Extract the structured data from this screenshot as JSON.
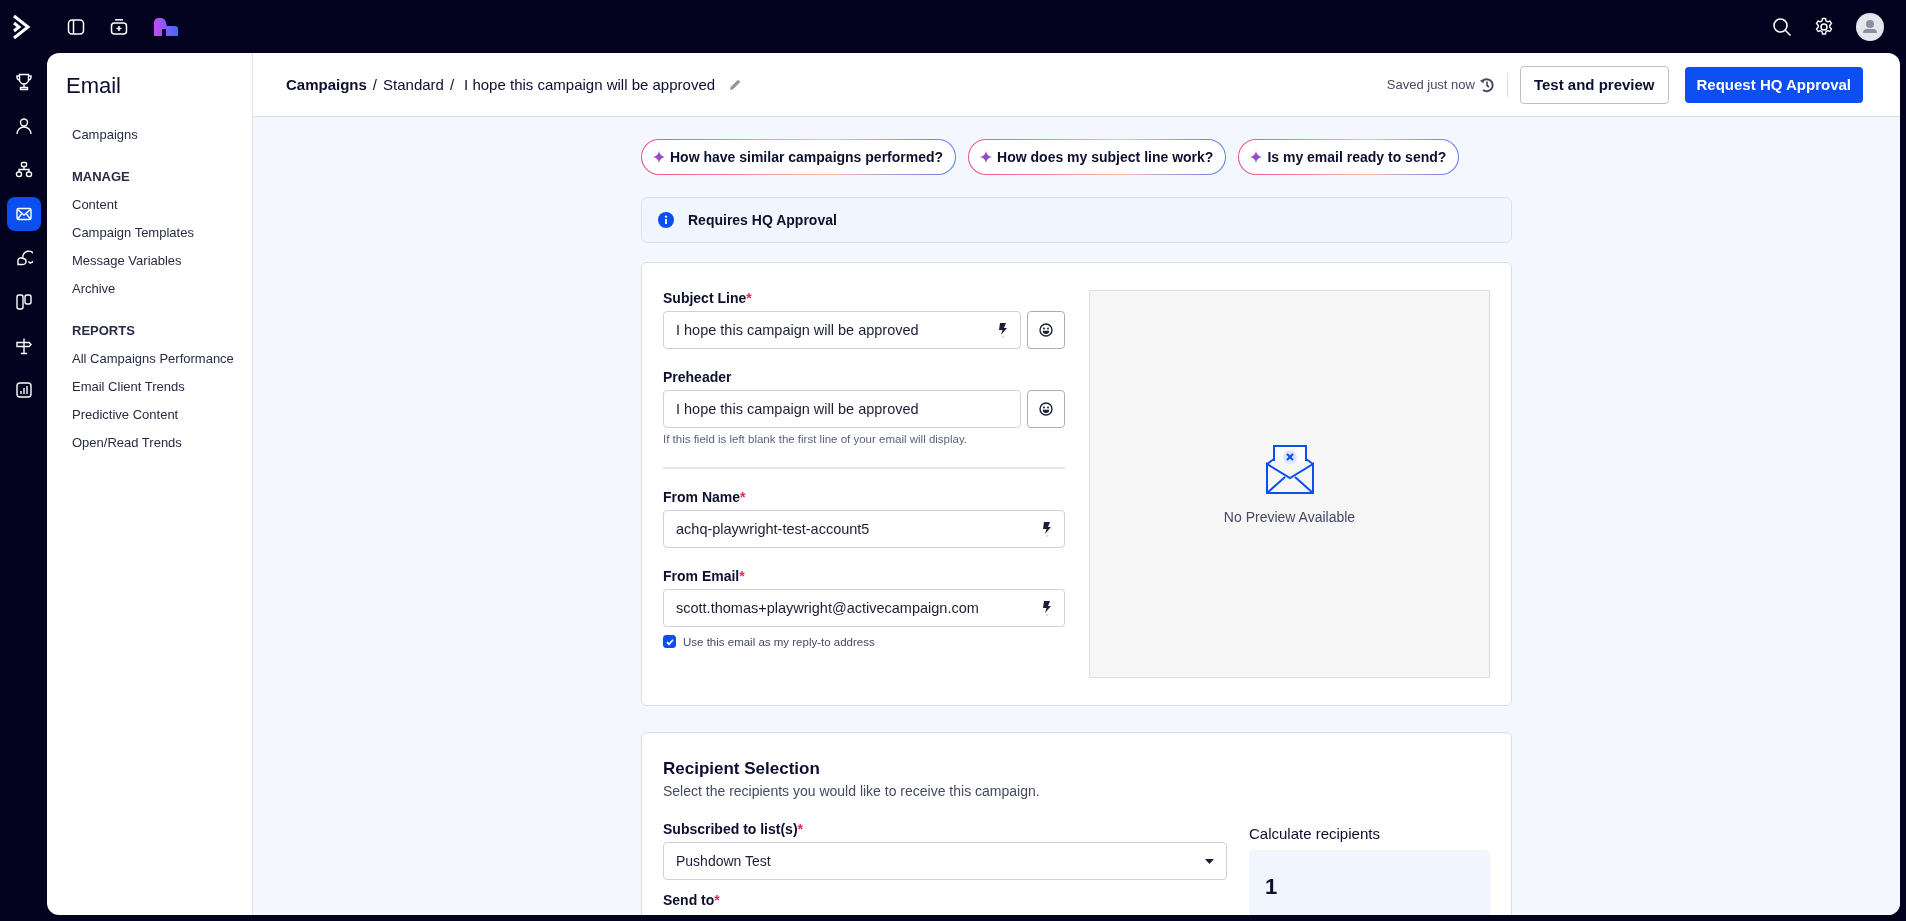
{
  "rail": {
    "items": [
      {
        "selected": false
      },
      {
        "selected": false
      },
      {
        "selected": false
      },
      {
        "selected": true
      },
      {
        "selected": false
      },
      {
        "selected": false
      },
      {
        "selected": false
      },
      {
        "selected": false
      }
    ]
  },
  "sidebar": {
    "title": "Email",
    "top_items": [
      "Campaigns"
    ],
    "sections": [
      {
        "heading": "MANAGE",
        "items": [
          "Content",
          "Campaign Templates",
          "Message Variables",
          "Archive"
        ]
      },
      {
        "heading": "REPORTS",
        "items": [
          "All Campaigns Performance",
          "Email Client Trends",
          "Predictive Content",
          "Open/Read Trends"
        ]
      }
    ]
  },
  "header": {
    "breadcrumb": [
      "Campaigns",
      "Standard"
    ],
    "separator": "/",
    "title": "I hope this campaign will be approved",
    "save_status": "Saved just now",
    "buttons": [
      {
        "label": "Test and preview",
        "kind": "secondary"
      },
      {
        "label": "Request HQ Approval",
        "kind": "primary"
      }
    ]
  },
  "suggestions": [
    "How have similar campaigns performed?",
    "How does my subject line work?",
    "Is my email ready to send?"
  ],
  "notice": {
    "text": "Requires HQ Approval"
  },
  "message": {
    "fields": [
      {
        "label": "Subject Line",
        "required_mark": "*",
        "value": "I hope this campaign will be approved",
        "personalize": true,
        "emoji": true,
        "divider_before": false
      },
      {
        "label": "Preheader",
        "value": "I hope this campaign will be approved",
        "personalize": false,
        "emoji": true,
        "help": "If this field is left blank the first line of your email will display.",
        "divider_before": false
      },
      {
        "label": "From Name",
        "required_mark": "*",
        "value": "achq-playwright-test-account5",
        "personalize": true,
        "emoji": false,
        "divider_before": true
      },
      {
        "label": "From Email",
        "required_mark": "*",
        "value": "scott.thomas+playwright@activecampaign.com",
        "personalize": true,
        "emoji": false,
        "divider_before": false
      }
    ],
    "reply_to": {
      "label": "Use this email as my reply-to address",
      "checked": true
    },
    "preview": {
      "text": "No Preview Available"
    }
  },
  "recipients": {
    "title": "Recipient Selection",
    "description": "Select the recipients you would like to receive this campaign.",
    "list_label": "Subscribed to list(s)",
    "list_required_mark": "*",
    "list_value": "Pushdown Test",
    "send_to_label": "Send to",
    "send_to_required_mark": "*",
    "calc_label": "Calculate recipients",
    "count": "1"
  }
}
